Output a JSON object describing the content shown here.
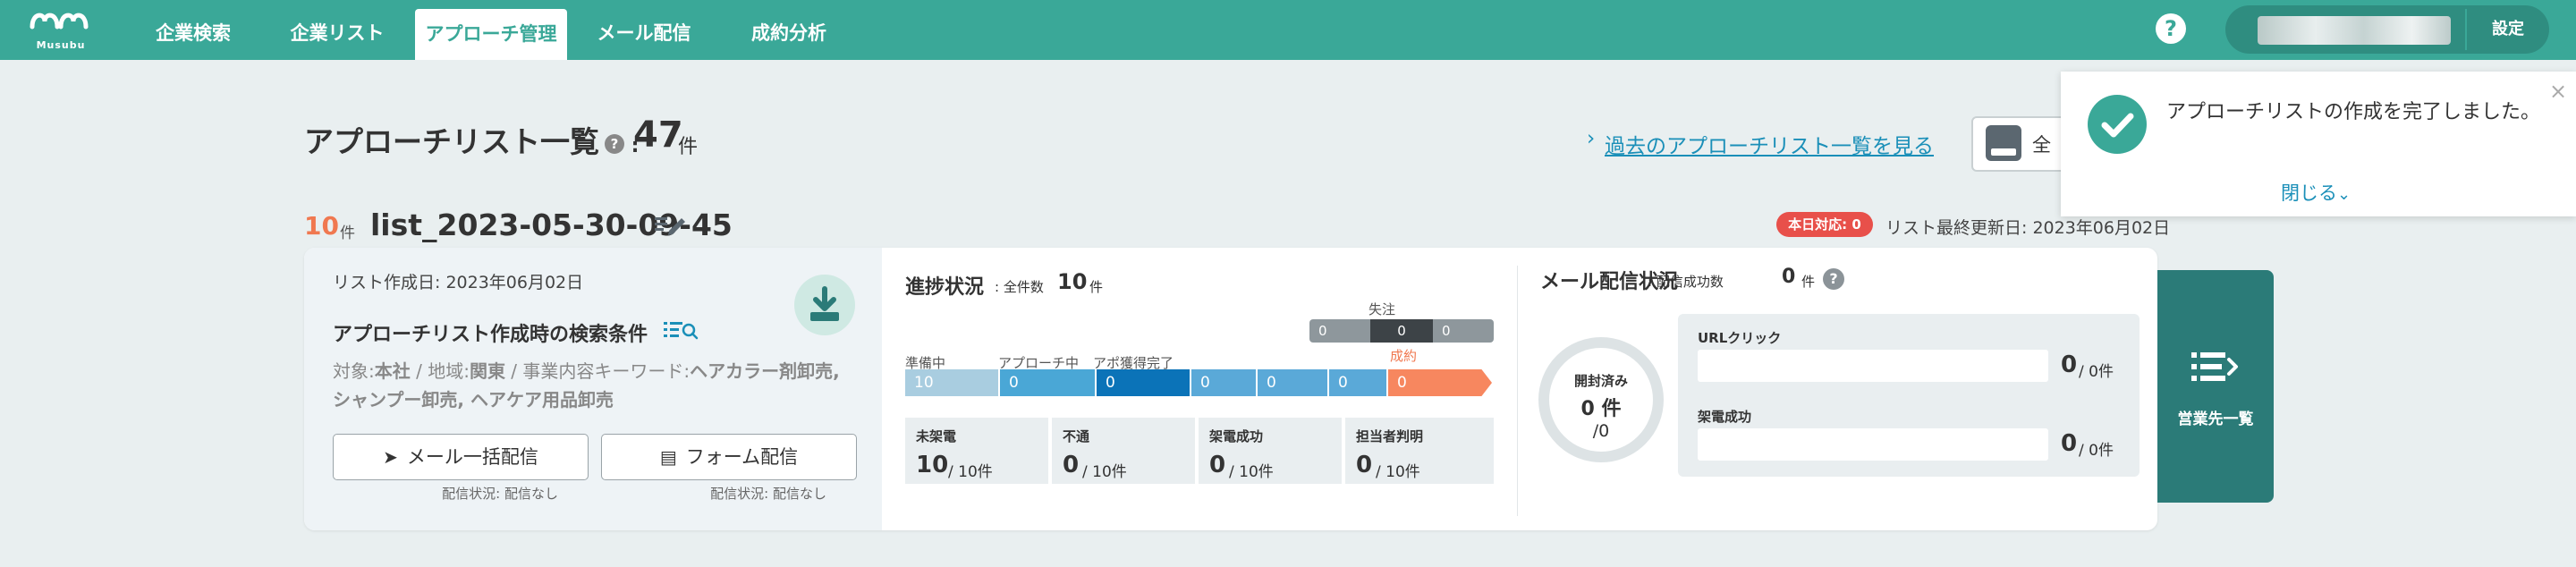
{
  "header": {
    "logo_text": "Musubu",
    "nav": [
      "企業検索",
      "企業リスト",
      "アプローチ管理",
      "メール配信",
      "成約分析"
    ],
    "active_nav": "アプローチ管理",
    "help_icon": "question-circle-icon",
    "settings_label": "設定",
    "colors": {
      "bar": "#3aa898",
      "active_text": "#3aa898"
    }
  },
  "page": {
    "title": "アプローチリスト一覧",
    "total_count": "47",
    "total_unit": "件",
    "past_link": "過去のアプローチリスト一覧を見る",
    "all_button_label": "全"
  },
  "list": {
    "count": "10",
    "count_unit": "件",
    "name": "list_2023-05-30-09-45",
    "today_badge": "本日対応: 0",
    "last_updated": "リスト最終更新日: 2023年06月02日",
    "created_date": "リスト作成日: 2023年06月02日",
    "condition_title": "アプローチリスト作成時の検索条件",
    "conditions": {
      "target_label": "対象:",
      "target_value": "本社",
      "region_label": "地域:",
      "region_value": "関東",
      "keyword_label": "事業内容キーワード:",
      "keyword_value": "ヘアカラー剤卸売, シャンプー卸売, ヘアケア用品卸売"
    },
    "mail_button": "メール一括配信",
    "form_button": "フォーム配信",
    "mail_status": "配信状況: 配信なし",
    "form_status": "配信状況: 配信なし"
  },
  "progress": {
    "title": "進捗状況",
    "total_label": ": 全件数",
    "total_value": "10",
    "total_unit": "件",
    "lost_label": "失注",
    "lost_values": [
      "0",
      "0",
      "0"
    ],
    "stage_labels": {
      "prep": "準備中",
      "approach": "アプローチ中",
      "appointment": "アポ獲得完了",
      "closed": "成約"
    },
    "stage_values": [
      "10",
      "0",
      "0",
      "0",
      "0",
      "0",
      "0"
    ],
    "stats": [
      {
        "label": "未架電",
        "value": "10",
        "of": "/ 10件"
      },
      {
        "label": "不通",
        "value": "0",
        "of": "/ 10件"
      },
      {
        "label": "架電成功",
        "value": "0",
        "of": "/ 10件"
      },
      {
        "label": "担当者判明",
        "value": "0",
        "of": "/ 10件"
      }
    ]
  },
  "mail": {
    "title": "メール配信状況",
    "success_label": ": 配信成功数",
    "success_value": "0",
    "success_unit": "件",
    "opened_label": "開封済み",
    "opened_value": "0 件",
    "opened_total": "/0",
    "url_click_label": "URLクリック",
    "url_click_value": "0",
    "url_click_of": "/ 0件",
    "call_success_label": "架電成功",
    "call_success_value": "0",
    "call_success_of": "/ 0件"
  },
  "side": {
    "sales_list_label": "営業先一覧"
  },
  "toast": {
    "message": "アプローチリストの作成を完了しました。",
    "close_link": "閉じる"
  }
}
